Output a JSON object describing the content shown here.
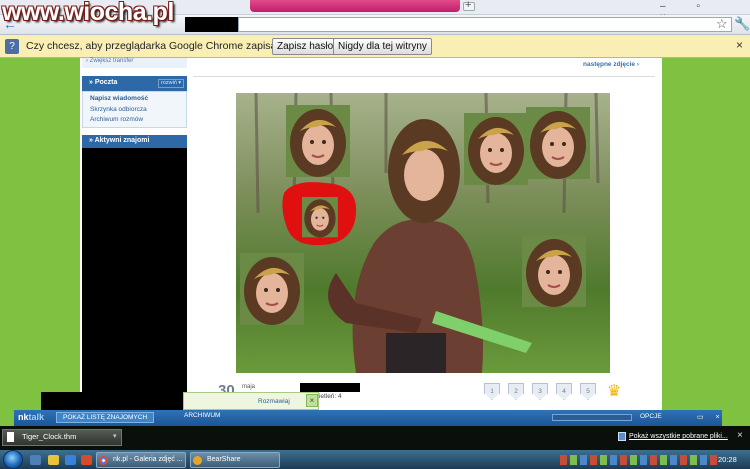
{
  "watermark": "www.wiocha.pl",
  "browser": {
    "new_tab_icon": "plus-icon",
    "window_controls": "– ▫ ×",
    "back_glyph": "←",
    "star_glyph": "☆",
    "wrench_glyph": "🔧"
  },
  "infobar": {
    "message": "Czy chcesz, aby przeglądarka Google Chrome zapisała hasło?",
    "save_label": "Zapisz hasło",
    "never_label": "Nigdy dla tej witryny",
    "close_glyph": "×"
  },
  "sidebar": {
    "transfer_link": "› Zwiększ transfer",
    "mail_title": "» Poczta",
    "expand_label": "rozwiń ▾",
    "mail_items": [
      "Napisz wiadomość",
      "Skrzynka odbiorcza",
      "Archiwum rozmów"
    ],
    "friends_title": "» Aktywni znajomi"
  },
  "photo_nav": {
    "next_label": "następne zdjęcie ›"
  },
  "photo_stats": {
    "day": "30",
    "month": "maja",
    "views": "wyświetleń: 4",
    "ratings": [
      "1",
      "2",
      "3",
      "4",
      "5"
    ],
    "top_rating_glyph": "♛"
  },
  "chat_popup": {
    "talk_label": "Rozmawiaj",
    "close_glyph": "×"
  },
  "nktalk": {
    "logo_nk": "nk",
    "logo_talk": "talk",
    "friends_btn": "POKAŻ LISTĘ ZNAJOMYCH",
    "archive_btn": "ARCHIWUM",
    "options_btn": "OPCJE",
    "window_glyphs": "▭ ×"
  },
  "download_shelf": {
    "file_name": "Tiger_Clock.thm",
    "arrow": "▾",
    "show_all": "Pokaż wszystkie pobrane pliki...",
    "close_glyph": "×"
  },
  "taskbar": {
    "task_chrome": "nk.pl - Galeria zdjęć ...",
    "task_bear": "BearShare",
    "clock": "20:28"
  },
  "colors": {
    "page_bg": "#7fc241",
    "nk_blue": "#2e69a7",
    "infobar_bg": "#f9efb4"
  }
}
